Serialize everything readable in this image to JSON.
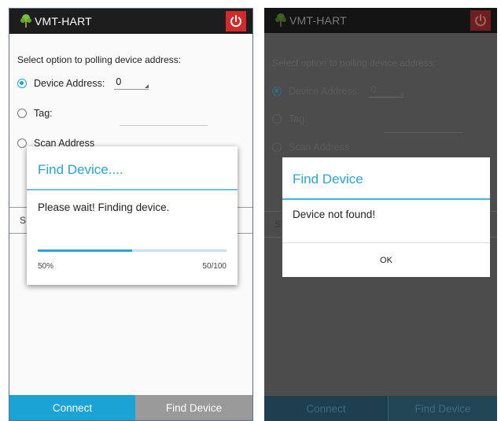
{
  "colors": {
    "accent": "#1ba3d6",
    "power_red": "#d22a2a",
    "appbar": "#1d1d1d",
    "find_tab": "#9a9a9a"
  },
  "left_screen": {
    "app_title": "VMT-HART",
    "logo_icon": "green-tree-icon",
    "power_icon": "power-icon",
    "prompt": "Select option to polling device address:",
    "options": {
      "device_address": "Device Address:",
      "device_address_value": "0",
      "tag": "Tag:",
      "scan_address": "Scan Address"
    },
    "peek_letter": "S",
    "dialog": {
      "title": "Find Device....",
      "message": "Please wait! Finding device.",
      "progress": 0.5,
      "percent_label": "50%",
      "count_label": "50/100"
    },
    "bottom": {
      "connect": "Connect",
      "find_device": "Find Device"
    }
  },
  "right_screen": {
    "app_title": "VMT-HART",
    "logo_icon": "green-tree-icon",
    "power_icon": "power-icon",
    "prompt": "Select option to polling device address:",
    "options": {
      "device_address": "Device Address:",
      "device_address_value": "0",
      "tag": "Tag:",
      "scan_address": "Scan Address"
    },
    "peek_letter": "S",
    "dialog": {
      "title": "Find Device",
      "message": "Device not found!",
      "ok": "OK"
    },
    "bottom": {
      "connect": "Connect",
      "find_device": "Find Device"
    }
  }
}
